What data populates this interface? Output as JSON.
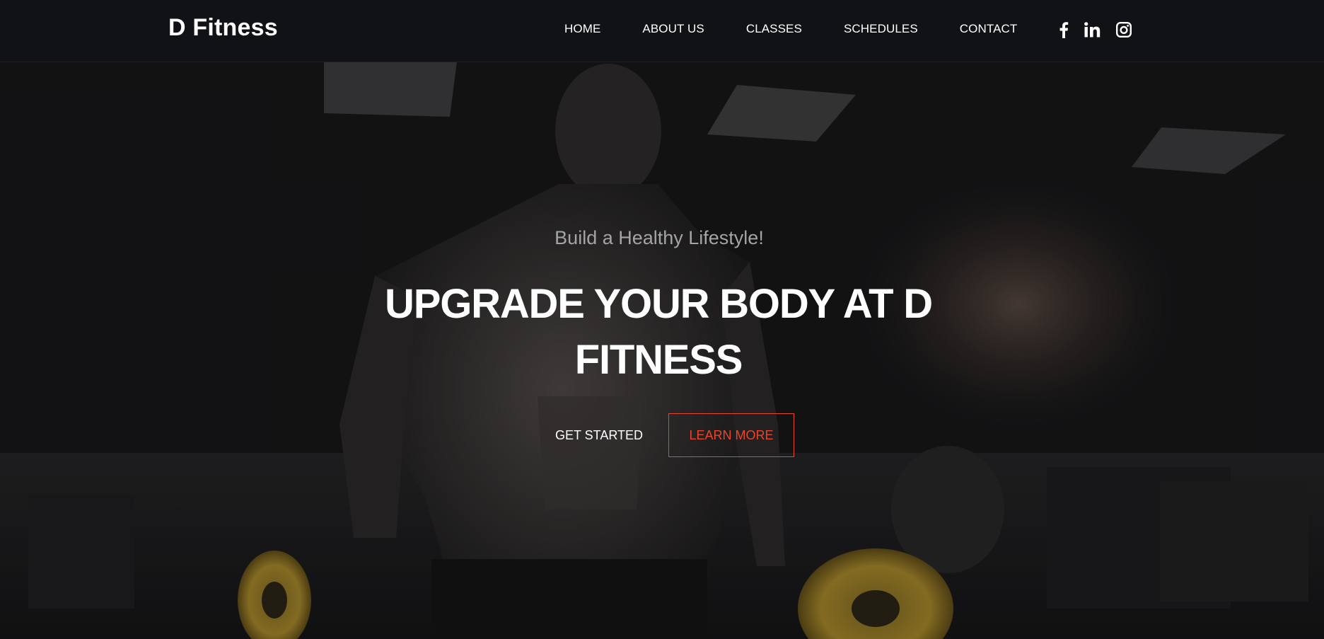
{
  "header": {
    "brand": "D Fitness",
    "nav": [
      {
        "label": "HOME"
      },
      {
        "label": "ABOUT US"
      },
      {
        "label": "CLASSES"
      },
      {
        "label": "SCHEDULES"
      },
      {
        "label": "CONTACT"
      }
    ],
    "socials": [
      {
        "icon": "facebook-icon"
      },
      {
        "icon": "linkedin-icon"
      },
      {
        "icon": "instagram-icon"
      }
    ]
  },
  "hero": {
    "tagline": "Build a Healthy Lifestyle!",
    "headline": "UPGRADE YOUR BODY AT D FITNESS",
    "get_started_label": "GET STARTED",
    "learn_more_label": "LEARN MORE",
    "background_icon": "gym-athlete-photo"
  },
  "colors": {
    "accent": "#e8452c",
    "header_bg": "#121316",
    "text": "#ffffff",
    "tagline": "#a4a4a6"
  }
}
